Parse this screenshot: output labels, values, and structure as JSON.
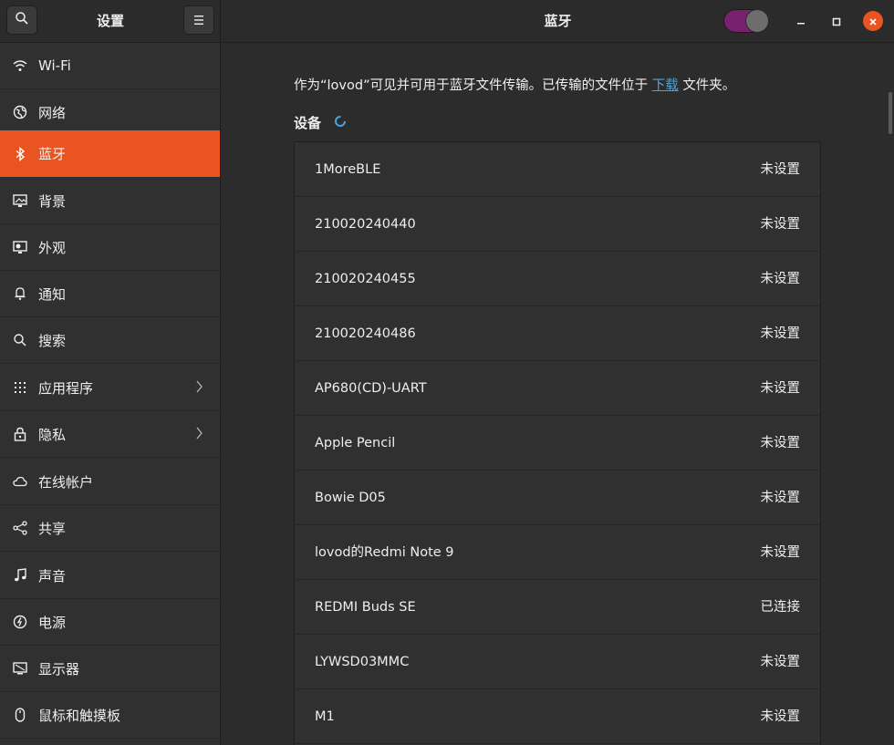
{
  "window": {
    "sidebar_title": "设置",
    "panel_title": "蓝牙",
    "bluetooth_enabled": true,
    "colors": {
      "accent": "#e95420",
      "toggle_on": "#77216f",
      "link": "#4aa3df"
    }
  },
  "titlebar": {
    "search_icon": "search-icon",
    "menu_icon": "hamburger-menu-icon",
    "minimize_icon": "minimize-icon",
    "maximize_icon": "maximize-icon",
    "close_icon": "close-icon"
  },
  "sidebar": {
    "items": [
      {
        "label": "Wi-Fi",
        "icon": "wifi-icon"
      },
      {
        "label": "网络",
        "icon": "network-icon"
      },
      {
        "label": "蓝牙",
        "icon": "bluetooth-icon",
        "active": true
      },
      {
        "label": "背景",
        "icon": "background-icon"
      },
      {
        "label": "外观",
        "icon": "appearance-icon"
      },
      {
        "label": "通知",
        "icon": "bell-icon"
      },
      {
        "label": "搜索",
        "icon": "search-icon"
      },
      {
        "label": "应用程序",
        "icon": "grid-icon",
        "chevron": true
      },
      {
        "label": "隐私",
        "icon": "lock-icon",
        "chevron": true
      },
      {
        "label": "在线帐户",
        "icon": "cloud-icon"
      },
      {
        "label": "共享",
        "icon": "share-icon"
      },
      {
        "label": "声音",
        "icon": "music-note-icon"
      },
      {
        "label": "电源",
        "icon": "power-icon"
      },
      {
        "label": "显示器",
        "icon": "display-icon"
      },
      {
        "label": "鼠标和触摸板",
        "icon": "mouse-icon"
      }
    ]
  },
  "main": {
    "intro_before": "作为“lovod”可见并可用于蓝牙文件传输。已传输的文件位于",
    "intro_link": "下载",
    "intro_after": "文件夹。",
    "devices_heading": "设备",
    "devices": [
      {
        "name": "1MoreBLE",
        "status": "未设置"
      },
      {
        "name": "210020240440",
        "status": "未设置"
      },
      {
        "name": "210020240455",
        "status": "未设置"
      },
      {
        "name": "210020240486",
        "status": "未设置"
      },
      {
        "name": "AP680(CD)-UART",
        "status": "未设置"
      },
      {
        "name": "Apple Pencil",
        "status": "未设置"
      },
      {
        "name": "Bowie D05",
        "status": "未设置"
      },
      {
        "name": "lovod的Redmi Note 9",
        "status": "未设置"
      },
      {
        "name": "REDMI Buds SE",
        "status": "已连接"
      },
      {
        "name": "LYWSD03MMC",
        "status": "未设置"
      },
      {
        "name": "M1",
        "status": "未设置"
      }
    ]
  }
}
